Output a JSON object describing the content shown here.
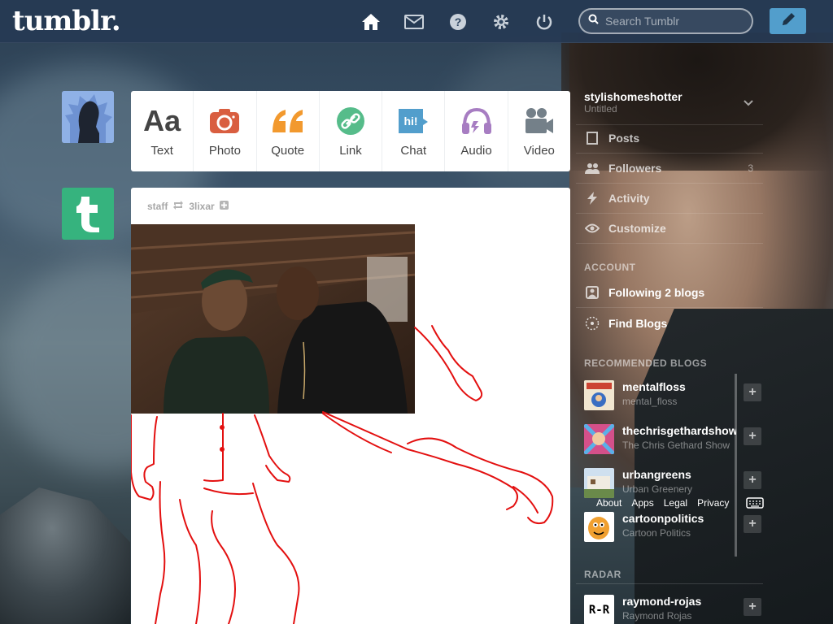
{
  "header": {
    "logo": "tumblr.",
    "search_placeholder": "Search Tumblr",
    "icons": [
      "home-icon",
      "inbox-icon",
      "help-icon",
      "settings-icon",
      "power-icon",
      "compose-icon"
    ]
  },
  "post_types": [
    {
      "label": "Text",
      "icon": "text-icon",
      "color": "#444444"
    },
    {
      "label": "Photo",
      "icon": "camera-icon",
      "color": "#d95e40"
    },
    {
      "label": "Quote",
      "icon": "quote-icon",
      "color": "#f2992e"
    },
    {
      "label": "Link",
      "icon": "link-icon",
      "color": "#56bc8a"
    },
    {
      "label": "Chat",
      "icon": "chat-icon",
      "color": "#529ecc"
    },
    {
      "label": "Audio",
      "icon": "headphones-icon",
      "color": "#a77dc2"
    },
    {
      "label": "Video",
      "icon": "video-camera-icon",
      "color": "#748089"
    }
  ],
  "post": {
    "author": "staff",
    "reblogged_from": "3lixar"
  },
  "sidebar": {
    "blog_name": "stylishomeshotter",
    "blog_sub": "Untitled",
    "items": [
      {
        "label": "Posts",
        "icon": "document-icon",
        "count": ""
      },
      {
        "label": "Followers",
        "icon": "followers-icon",
        "count": "3"
      },
      {
        "label": "Activity",
        "icon": "activity-icon",
        "count": ""
      },
      {
        "label": "Customize",
        "icon": "eye-icon",
        "count": ""
      }
    ],
    "account_heading": "ACCOUNT",
    "account_items": [
      {
        "label": "Following 2 blogs",
        "icon": "following-icon"
      },
      {
        "label": "Find Blogs",
        "icon": "compass-icon"
      }
    ],
    "recommended_heading": "RECOMMENDED BLOGS",
    "recommended": [
      {
        "name": "mentalfloss",
        "desc": "mental_floss",
        "thumb_color": "#e8d8c0"
      },
      {
        "name": "thechrisgethardshow",
        "desc": "The Chris Gethard Show",
        "thumb_color": "#d4508a"
      },
      {
        "name": "urbangreens",
        "desc": "Urban Greenery",
        "thumb_color": "#6a8a4a"
      },
      {
        "name": "cartoonpolitics",
        "desc": "Cartoon Politics",
        "thumb_color": "#f0a030"
      }
    ],
    "radar_heading": "RADAR",
    "radar": {
      "name": "raymond-rojas",
      "desc": "Raymond Rojas",
      "thumb_text": "R-R"
    }
  },
  "footer_links": [
    "About",
    "Apps",
    "Legal",
    "Privacy"
  ],
  "colors": {
    "header_bg": "#263a54",
    "compose_bg": "#529ecc",
    "staff_avatar": "#36b37e",
    "user_avatar": "#8fb1e6"
  }
}
